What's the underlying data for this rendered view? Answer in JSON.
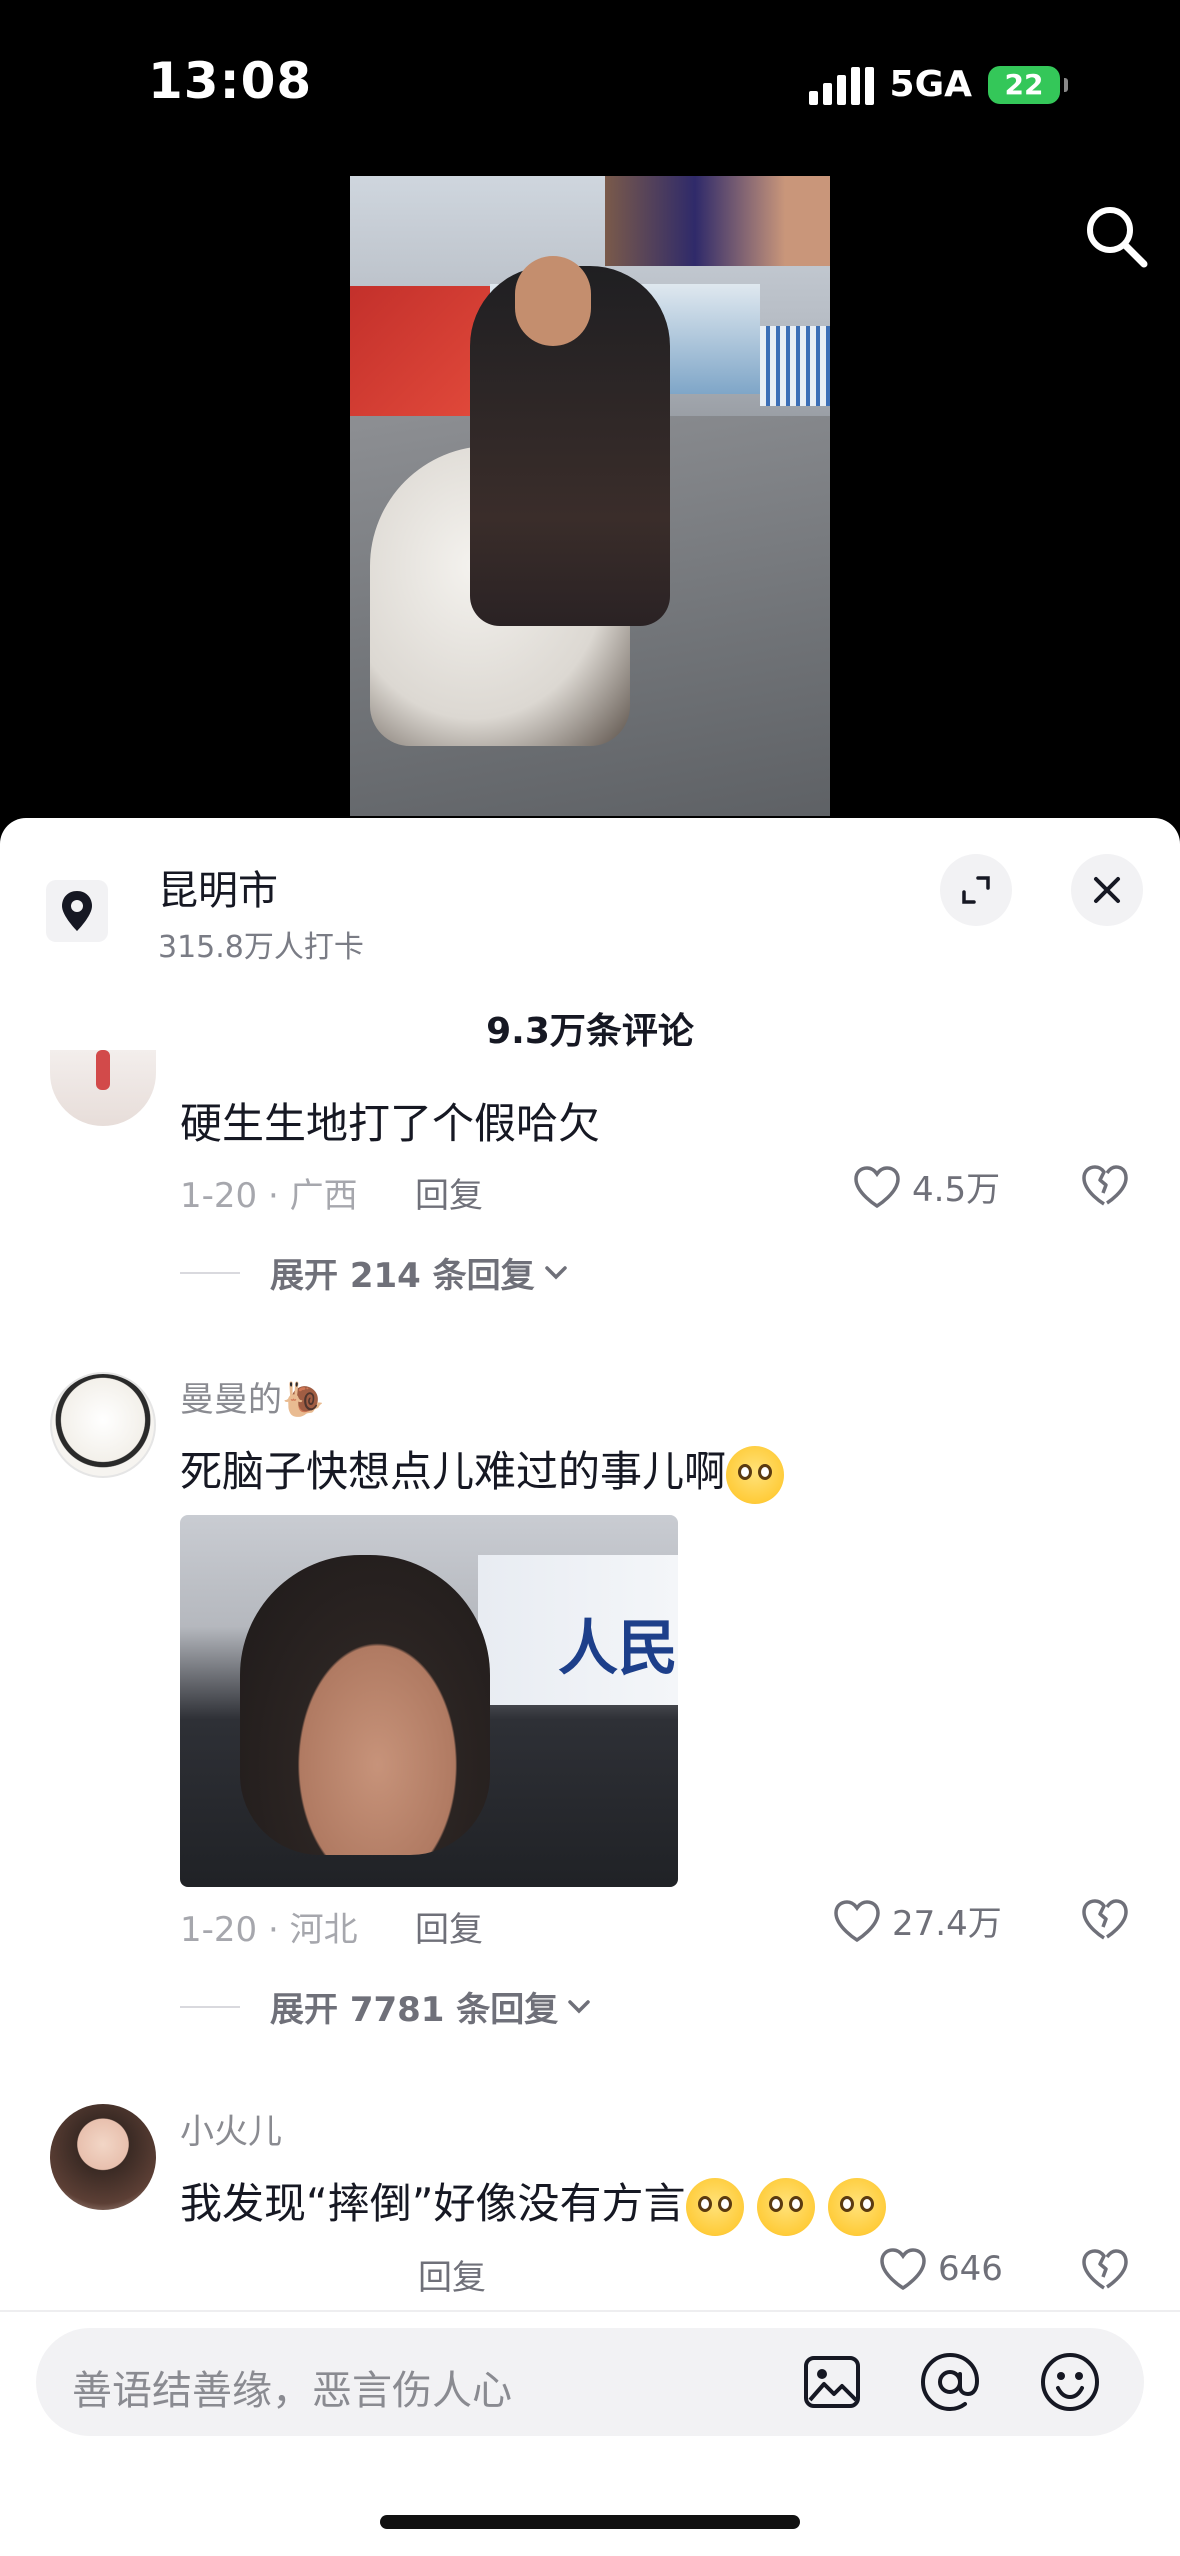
{
  "status_bar": {
    "time": "13:08",
    "network": "5GA",
    "battery": "22"
  },
  "video": {
    "search_icon": "search-icon"
  },
  "location": {
    "name": "昆明市",
    "checkins": "315.8万人打卡"
  },
  "comments_header": {
    "count": "9.3万条评论"
  },
  "comments": [
    {
      "text": "硬生生地打了个假哈欠",
      "meta": "1-20 · 广西",
      "reply": "回复",
      "likes": "4.5万",
      "expand": "展开 214 条回复"
    },
    {
      "user": "曼曼的🐌",
      "text": "死脑子快想点儿难过的事儿啊",
      "meta": "1-20 · 河北",
      "reply": "回复",
      "likes": "27.4万",
      "expand": "展开 7781 条回复",
      "image_text": "人民"
    },
    {
      "user": "小火儿",
      "text": "我发现“摔倒”好像没有方言",
      "reply": "回复",
      "likes": "646"
    }
  ],
  "input": {
    "placeholder": "善语结善缘，恶言伤人心"
  },
  "colors": {
    "battery": "#34c759",
    "sheet_bg": "#ffffff",
    "muted": "#8a8b91"
  }
}
